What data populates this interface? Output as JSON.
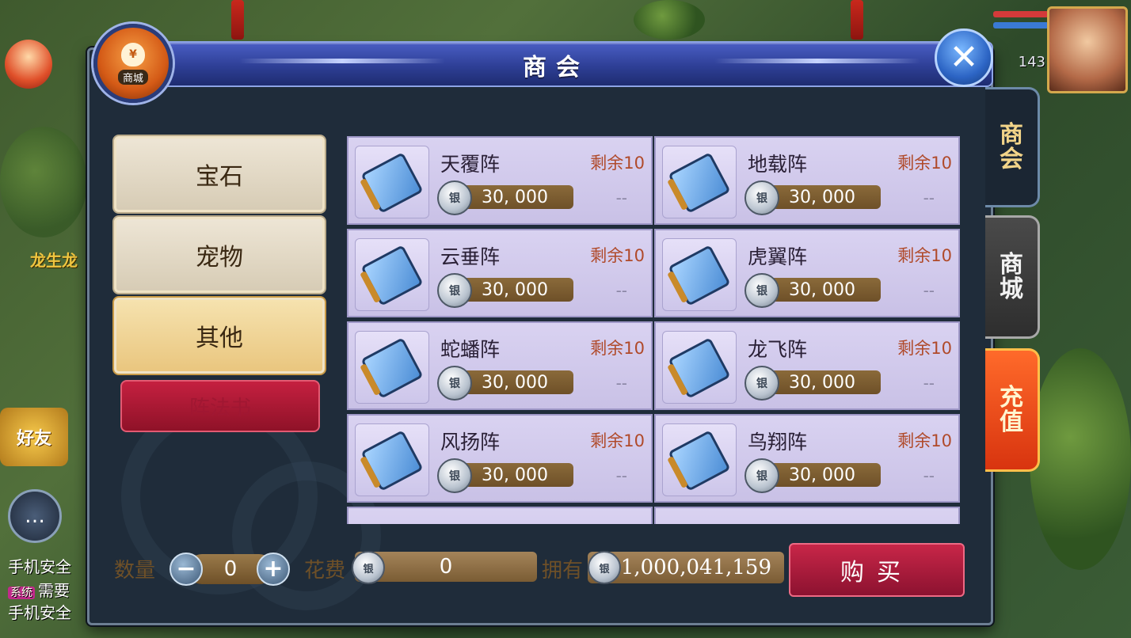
{
  "world": {
    "npc_name": "龙生龙",
    "friends_label": "好友",
    "chat_lines": [
      {
        "text": "手机安全"
      },
      {
        "tag": "系统",
        "text": "需要"
      },
      {
        "text": "手机安全"
      }
    ],
    "level": "143"
  },
  "dialog": {
    "title": "商会",
    "emblem_label": "商城",
    "emblem_symbol": "¥",
    "close_symbol": "✕"
  },
  "side_tabs": [
    {
      "label": "商\n会",
      "state": "active"
    },
    {
      "label": "商\n城",
      "state": "normal"
    },
    {
      "label": "充\n值",
      "state": "recharge"
    }
  ],
  "categories": [
    {
      "label": "宝石",
      "active": false
    },
    {
      "label": "宠物",
      "active": false
    },
    {
      "label": "其他",
      "active": true
    }
  ],
  "subcategory": {
    "label": "阵法书"
  },
  "items": [
    {
      "name": "天覆阵",
      "remain": "剩余10",
      "price": "30, 000",
      "extra": "--"
    },
    {
      "name": "地载阵",
      "remain": "剩余10",
      "price": "30, 000",
      "extra": "--"
    },
    {
      "name": "云垂阵",
      "remain": "剩余10",
      "price": "30, 000",
      "extra": "--"
    },
    {
      "name": "虎翼阵",
      "remain": "剩余10",
      "price": "30, 000",
      "extra": "--"
    },
    {
      "name": "蛇蟠阵",
      "remain": "剩余10",
      "price": "30, 000",
      "extra": "--"
    },
    {
      "name": "龙飞阵",
      "remain": "剩余10",
      "price": "30, 000",
      "extra": "--"
    },
    {
      "name": "风扬阵",
      "remain": "剩余10",
      "price": "30, 000",
      "extra": "--"
    },
    {
      "name": "鸟翔阵",
      "remain": "剩余10",
      "price": "30, 000",
      "extra": "--"
    }
  ],
  "purchase": {
    "qty_label": "数量",
    "qty_value": "0",
    "minus": "−",
    "plus": "+",
    "cost_label": "花费",
    "cost_value": "0",
    "own_label": "拥有",
    "own_value": "1,000,041,159",
    "buy_label": "购买"
  },
  "colors": {
    "dialog_bg": "#1f2c3a",
    "title_bar": "#2e3f96",
    "item_bg": "#d9d2f1",
    "buy_button": "#c82648",
    "active_category": "#e9c57d"
  }
}
